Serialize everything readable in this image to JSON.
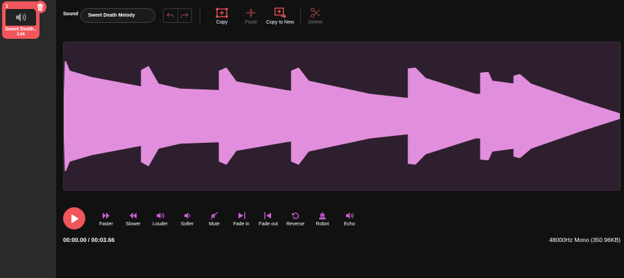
{
  "sidebar": {
    "sound": {
      "number": "1",
      "name": "Sweet Death...",
      "duration": "3.66"
    }
  },
  "toolbar": {
    "sound_label": "Sound",
    "sound_name": "Sweet Death Melody",
    "copy": "Copy",
    "paste": "Paste",
    "copy_to_new": "Copy to New",
    "delete": "Delete"
  },
  "effects": [
    "Faster",
    "Slower",
    "Louder",
    "Softer",
    "Mute",
    "Fade in",
    "Fade out",
    "Reverse",
    "Robot",
    "Echo"
  ],
  "status": {
    "time": "00:00.00 / 00:03.66",
    "info": "48000Hz Mono (350.96KB)"
  },
  "colors": {
    "accent": "#f0565c",
    "effect_icon": "#c85fd0",
    "waveform_fill": "#e18edc",
    "waveform_bg": "#2e1f2e"
  },
  "waveform": {
    "envelope": [
      [
        0.0,
        0.0
      ],
      [
        0.003,
        0.75
      ],
      [
        0.01,
        0.62
      ],
      [
        0.05,
        0.53
      ],
      [
        0.14,
        0.4
      ],
      [
        0.14,
        0.63
      ],
      [
        0.152,
        0.68
      ],
      [
        0.17,
        0.44
      ],
      [
        0.21,
        0.37
      ],
      [
        0.28,
        0.35
      ],
      [
        0.28,
        0.62
      ],
      [
        0.292,
        0.66
      ],
      [
        0.31,
        0.47
      ],
      [
        0.4,
        0.35
      ],
      [
        0.41,
        0.34
      ],
      [
        0.41,
        0.62
      ],
      [
        0.422,
        0.66
      ],
      [
        0.44,
        0.48
      ],
      [
        0.55,
        0.3
      ],
      [
        0.62,
        0.24
      ],
      [
        0.62,
        0.65
      ],
      [
        0.632,
        0.66
      ],
      [
        0.65,
        0.52
      ],
      [
        0.74,
        0.3
      ],
      [
        0.75,
        0.3
      ],
      [
        0.75,
        0.59
      ],
      [
        0.763,
        0.6
      ],
      [
        0.77,
        0.48
      ],
      [
        0.81,
        0.44
      ],
      [
        0.81,
        0.55
      ],
      [
        0.82,
        0.57
      ],
      [
        0.84,
        0.44
      ],
      [
        0.93,
        0.2
      ],
      [
        1.0,
        0.03
      ]
    ]
  }
}
